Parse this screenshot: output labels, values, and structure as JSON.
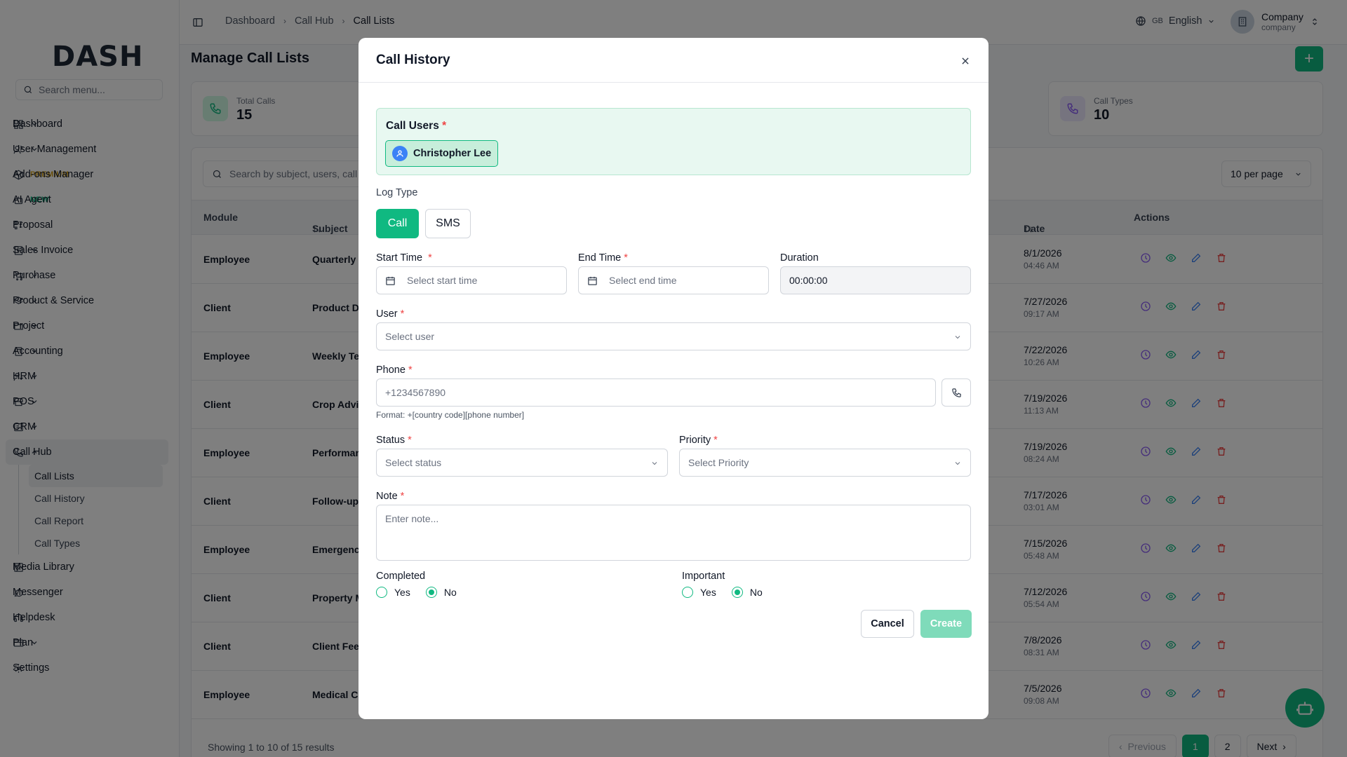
{
  "app": {
    "logo": "DASH"
  },
  "sidebar": {
    "search_placeholder": "Search menu...",
    "items": [
      {
        "label": "Dashboard",
        "icon": "grid-icon",
        "chevron": true
      },
      {
        "label": "User Management",
        "icon": "users-icon",
        "chevron": true
      },
      {
        "label": "Add-ons Manager",
        "icon": "package-icon",
        "badge": "PREMIUM"
      },
      {
        "label": "AI Agent",
        "icon": "bot-icon",
        "badge": "NEW"
      },
      {
        "label": "Proposal",
        "icon": "proposal-icon"
      },
      {
        "label": "Sales Invoice",
        "icon": "invoice-icon",
        "chevron": true
      },
      {
        "label": "Purchase",
        "icon": "cart-icon",
        "chevron": true
      },
      {
        "label": "Product & Service",
        "icon": "layers-icon",
        "chevron": true
      },
      {
        "label": "Project",
        "icon": "folder-icon",
        "chevron": true
      },
      {
        "label": "Accounting",
        "icon": "calculator-icon",
        "chevron": true
      },
      {
        "label": "HRM",
        "icon": "hrm-icon",
        "chevron": true
      },
      {
        "label": "POS",
        "icon": "pos-icon",
        "chevron": true
      },
      {
        "label": "CRM",
        "icon": "crm-icon",
        "chevron": true
      },
      {
        "label": "Call Hub",
        "icon": "phone-icon",
        "chevron": true
      }
    ],
    "callhub_sub": [
      "Call Lists",
      "Call History",
      "Call Report",
      "Call Types"
    ],
    "items_after": [
      {
        "label": "Media Library",
        "icon": "image-icon"
      },
      {
        "label": "Messenger",
        "icon": "message-icon"
      },
      {
        "label": "Helpdesk",
        "icon": "headset-icon"
      },
      {
        "label": "Plan",
        "icon": "plan-icon",
        "chevron": true
      },
      {
        "label": "Settings",
        "icon": "gear-icon"
      }
    ]
  },
  "topbar": {
    "breadcrumbs": [
      "Dashboard",
      "Call Hub",
      "Call Lists"
    ],
    "lang_code": "GB",
    "lang": "English",
    "company_name": "Company",
    "company_sub": "company"
  },
  "main": {
    "title": "Manage Call Lists",
    "stats": [
      {
        "label": "Total Calls",
        "value": "15"
      },
      {
        "label": "Call Types",
        "value": "10"
      }
    ],
    "search_placeholder": "Search by subject, users, call t",
    "per_page": "10 per page",
    "columns": {
      "module": "Module",
      "subject": "Subject",
      "date": "Date",
      "actions": "Actions"
    },
    "rows": [
      {
        "module": "Employee",
        "subject": "Quarterly I",
        "date": "8/1/2026",
        "time": "04:46 AM"
      },
      {
        "module": "Client",
        "subject": "Product De",
        "date": "7/27/2026",
        "time": "09:17 AM"
      },
      {
        "module": "Employee",
        "subject": "Weekly Tea",
        "date": "7/22/2026",
        "time": "10:26 AM"
      },
      {
        "module": "Client",
        "subject": "Crop Advis",
        "date": "7/19/2026",
        "time": "11:13 AM"
      },
      {
        "module": "Employee",
        "subject": "Performan",
        "date": "7/19/2026",
        "time": "08:24 AM"
      },
      {
        "module": "Client",
        "subject": "Follow-up",
        "date": "7/17/2026",
        "time": "03:01 AM"
      },
      {
        "module": "Employee",
        "subject": "Emergency",
        "date": "7/15/2026",
        "time": "05:48 AM"
      },
      {
        "module": "Client",
        "subject": "Property M",
        "date": "7/12/2026",
        "time": "05:54 AM"
      },
      {
        "module": "Client",
        "subject": "Client Feed",
        "date": "7/8/2026",
        "time": "08:31 AM"
      },
      {
        "module": "Employee",
        "subject": "Medical Co",
        "date": "7/5/2026",
        "time": "09:08 AM"
      }
    ],
    "footer_text": "Showing 1 to 10 of 15 results",
    "pager": {
      "prev": "Previous",
      "pages": [
        "1",
        "2"
      ],
      "next": "Next"
    }
  },
  "modal": {
    "title": "Call History",
    "call_users_label": "Call Users",
    "required_mark": "*",
    "selected_user": "Christopher Lee",
    "log_type_label": "Log Type",
    "log_types": [
      "Call",
      "SMS"
    ],
    "log_type_selected": "Call",
    "start_time_label": "Start Time",
    "start_time_placeholder": "Select start time",
    "end_time_label": "End Time",
    "end_time_placeholder": "Select end time",
    "duration_label": "Duration",
    "duration_value": "00:00:00",
    "user_label": "User",
    "user_placeholder": "Select user",
    "phone_label": "Phone",
    "phone_placeholder": "+1234567890",
    "phone_hint": "Format: +[country code][phone number]",
    "status_label": "Status",
    "status_placeholder": "Select status",
    "priority_label": "Priority",
    "priority_placeholder": "Select Priority",
    "note_label": "Note",
    "note_placeholder": "Enter note...",
    "completed_label": "Completed",
    "important_label": "Important",
    "yes": "Yes",
    "no": "No",
    "completed_value": "No",
    "important_value": "No",
    "cancel": "Cancel",
    "create": "Create"
  },
  "colors": {
    "accent": "#10b981",
    "danger": "#ef4444",
    "overlay": "rgba(0,0,0,0.5)"
  }
}
